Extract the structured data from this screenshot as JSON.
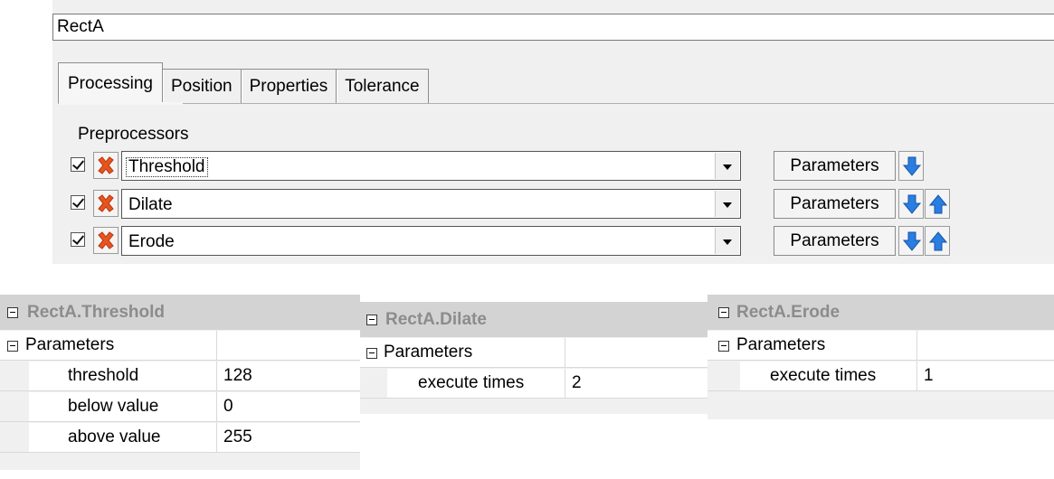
{
  "editor": {
    "name_value": "RectA",
    "tabs": [
      {
        "label": "Processing",
        "active": true
      },
      {
        "label": "Position",
        "active": false
      },
      {
        "label": "Properties",
        "active": false
      },
      {
        "label": "Tolerance",
        "active": false
      }
    ],
    "preprocessors_label": "Preprocessors",
    "preprocessors": [
      {
        "checked": true,
        "value": "Threshold",
        "parameters_label": "Parameters",
        "has_up": false
      },
      {
        "checked": true,
        "value": "Dilate",
        "parameters_label": "Parameters",
        "has_up": true
      },
      {
        "checked": true,
        "value": "Erode",
        "parameters_label": "Parameters",
        "has_up": true
      }
    ]
  },
  "grids": {
    "threshold": {
      "title": "RectA.Threshold",
      "group": "Parameters",
      "rows": [
        {
          "name": "threshold",
          "value": "128"
        },
        {
          "name": "below value",
          "value": "0"
        },
        {
          "name": "above value",
          "value": "255"
        }
      ]
    },
    "dilate": {
      "title": "RectA.Dilate",
      "group": "Parameters",
      "rows": [
        {
          "name": "execute times",
          "value": "2"
        }
      ]
    },
    "erode": {
      "title": "RectA.Erode",
      "group": "Parameters",
      "rows": [
        {
          "name": "execute times",
          "value": "1"
        }
      ]
    }
  },
  "colors": {
    "panel_bg": "#f0f0f0",
    "grid_header_bg": "#d3d3d3",
    "grid_title_text": "#8c8c8c",
    "delete_icon": "#e8541e",
    "arrow_icon": "#2a7de1"
  },
  "icons": {
    "delete": "delete-x-icon",
    "move_down": "arrow-down-icon",
    "move_up": "arrow-up-icon",
    "collapse": "collapse-minus-icon",
    "dropdown": "chevron-down-icon"
  }
}
